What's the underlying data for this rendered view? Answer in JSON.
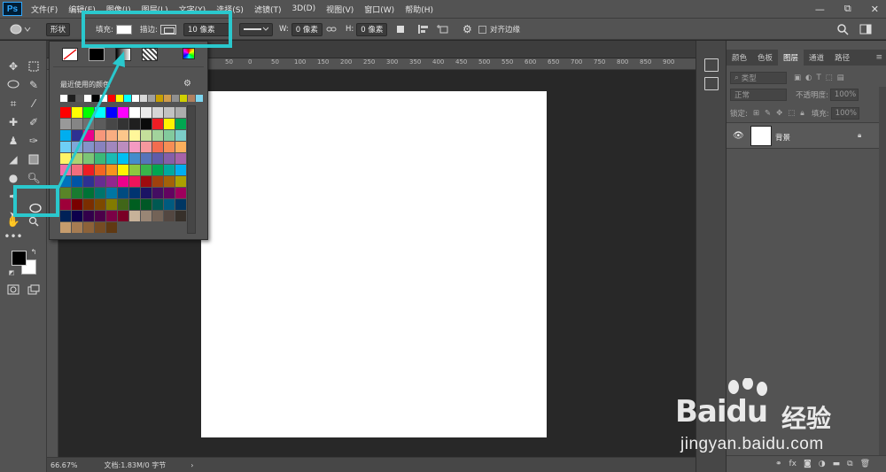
{
  "app": {
    "logo": "Ps",
    "menu": [
      "文件(F)",
      "编辑(E)",
      "图像(I)",
      "图层(L)",
      "文字(Y)",
      "选择(S)",
      "滤镜(T)",
      "3D(D)",
      "视图(V)",
      "窗口(W)",
      "帮助(H)"
    ],
    "window_controls": [
      "—",
      "⧉",
      "✕"
    ]
  },
  "options": {
    "tool_icon": "ellipse-shape-icon",
    "mode": "形状",
    "fill_label": "填充:",
    "stroke_label": "描边:",
    "stroke_size": "10 像素",
    "w_label": "W:",
    "w_value": "0 像素",
    "link_icon": "link-icon",
    "h_label": "H:",
    "h_value": "0 像素",
    "align_edges": "对齐边缘"
  },
  "color_popup": {
    "recent_label": "最近使用的颜色",
    "recent_colors": [
      "#ffffff",
      "#1e1e1e",
      "#5a5a5a",
      "#ffffff",
      "#000000",
      "#ffffff",
      "#ff0000",
      "#ffff00",
      "#00ffff",
      "#ffffff",
      "#d7d7d7",
      "#a0a0a0",
      "#c8a000",
      "#d09c4c",
      "#909090",
      "#d0d000",
      "#b08060",
      "#7ed7f0"
    ],
    "swatches": [
      "#ff0000",
      "#ffff00",
      "#00ff00",
      "#00ffff",
      "#0000ff",
      "#ff00ff",
      "#ffffff",
      "#ebebeb",
      "#d6d6d6",
      "#c2c2c2",
      "#adadad",
      "#999999",
      "#858585",
      "#707070",
      "#5c5c5c",
      "#474747",
      "#333333",
      "#1f1f1f",
      "#0a0a0a",
      "#ee1d24",
      "#fff200",
      "#00a650",
      "#00aeef",
      "#2e3192",
      "#ec008c",
      "#f7977a",
      "#f9ad81",
      "#fdc68a",
      "#fff79a",
      "#c4df9b",
      "#a2d39c",
      "#82ca9d",
      "#7bcdc8",
      "#6ecff6",
      "#7ea7d8",
      "#8493ca",
      "#8882be",
      "#a187be",
      "#bc8dbf",
      "#f49ac2",
      "#f6989d",
      "#f26c4f",
      "#f68e55",
      "#fbaf5c",
      "#fff467",
      "#acd372",
      "#7cc576",
      "#3bb878",
      "#1abbb4",
      "#00bff3",
      "#448ccb",
      "#5674b9",
      "#605ca8",
      "#855fa8",
      "#a763a8",
      "#f06ea9",
      "#f26d7d",
      "#ed1c24",
      "#f26522",
      "#f7941d",
      "#fff200",
      "#8dc73f",
      "#39b54a",
      "#00a651",
      "#00a99d",
      "#00aeef",
      "#0072bc",
      "#0054a6",
      "#2e3192",
      "#662d91",
      "#92278f",
      "#ec008c",
      "#ed145b",
      "#9e0b0f",
      "#a0410d",
      "#a36209",
      "#aba000",
      "#598527",
      "#197b30",
      "#007236",
      "#00746b",
      "#0076a3",
      "#004b80",
      "#003471",
      "#1b1464",
      "#440e62",
      "#630460",
      "#9e005d",
      "#9e0039",
      "#790000",
      "#7b2e00",
      "#7d4900",
      "#827b00",
      "#406618",
      "#005e20",
      "#005826",
      "#005952",
      "#005b7f",
      "#003663",
      "#002157",
      "#0d004c",
      "#32004b",
      "#4b0049",
      "#7b0046",
      "#7a0026",
      "#c7b299",
      "#998675",
      "#736357",
      "#534741",
      "#37302a",
      "#c69c6d",
      "#a67c52",
      "#8c6239",
      "#754c24",
      "#603913"
    ]
  },
  "tabs_panel": {
    "tabs": [
      "颜色",
      "色板",
      "图层",
      "通道",
      "路径"
    ],
    "active_tab": "图层",
    "filter_label": "类型",
    "blend_mode": "正常",
    "opacity_label": "不透明度:",
    "opacity_value": "100%",
    "lock_label": "锁定:",
    "fill_label": "填充:",
    "fill_value": "100%"
  },
  "layer": {
    "name": "背景"
  },
  "status": {
    "zoom": "66.67%",
    "doc_info": "文档:1.83M/0 字节"
  },
  "ruler": {
    "labels": [
      "50",
      "0",
      "50",
      "100",
      "150",
      "200",
      "250",
      "300",
      "350",
      "400",
      "450",
      "500",
      "550",
      "600",
      "650",
      "700",
      "750",
      "800",
      "850",
      "900",
      "950",
      "1000",
      "1050"
    ]
  },
  "watermark": {
    "bai": "Bai",
    "du": "du",
    "jingyan": "经验",
    "url": "jingyan.baidu.com"
  }
}
